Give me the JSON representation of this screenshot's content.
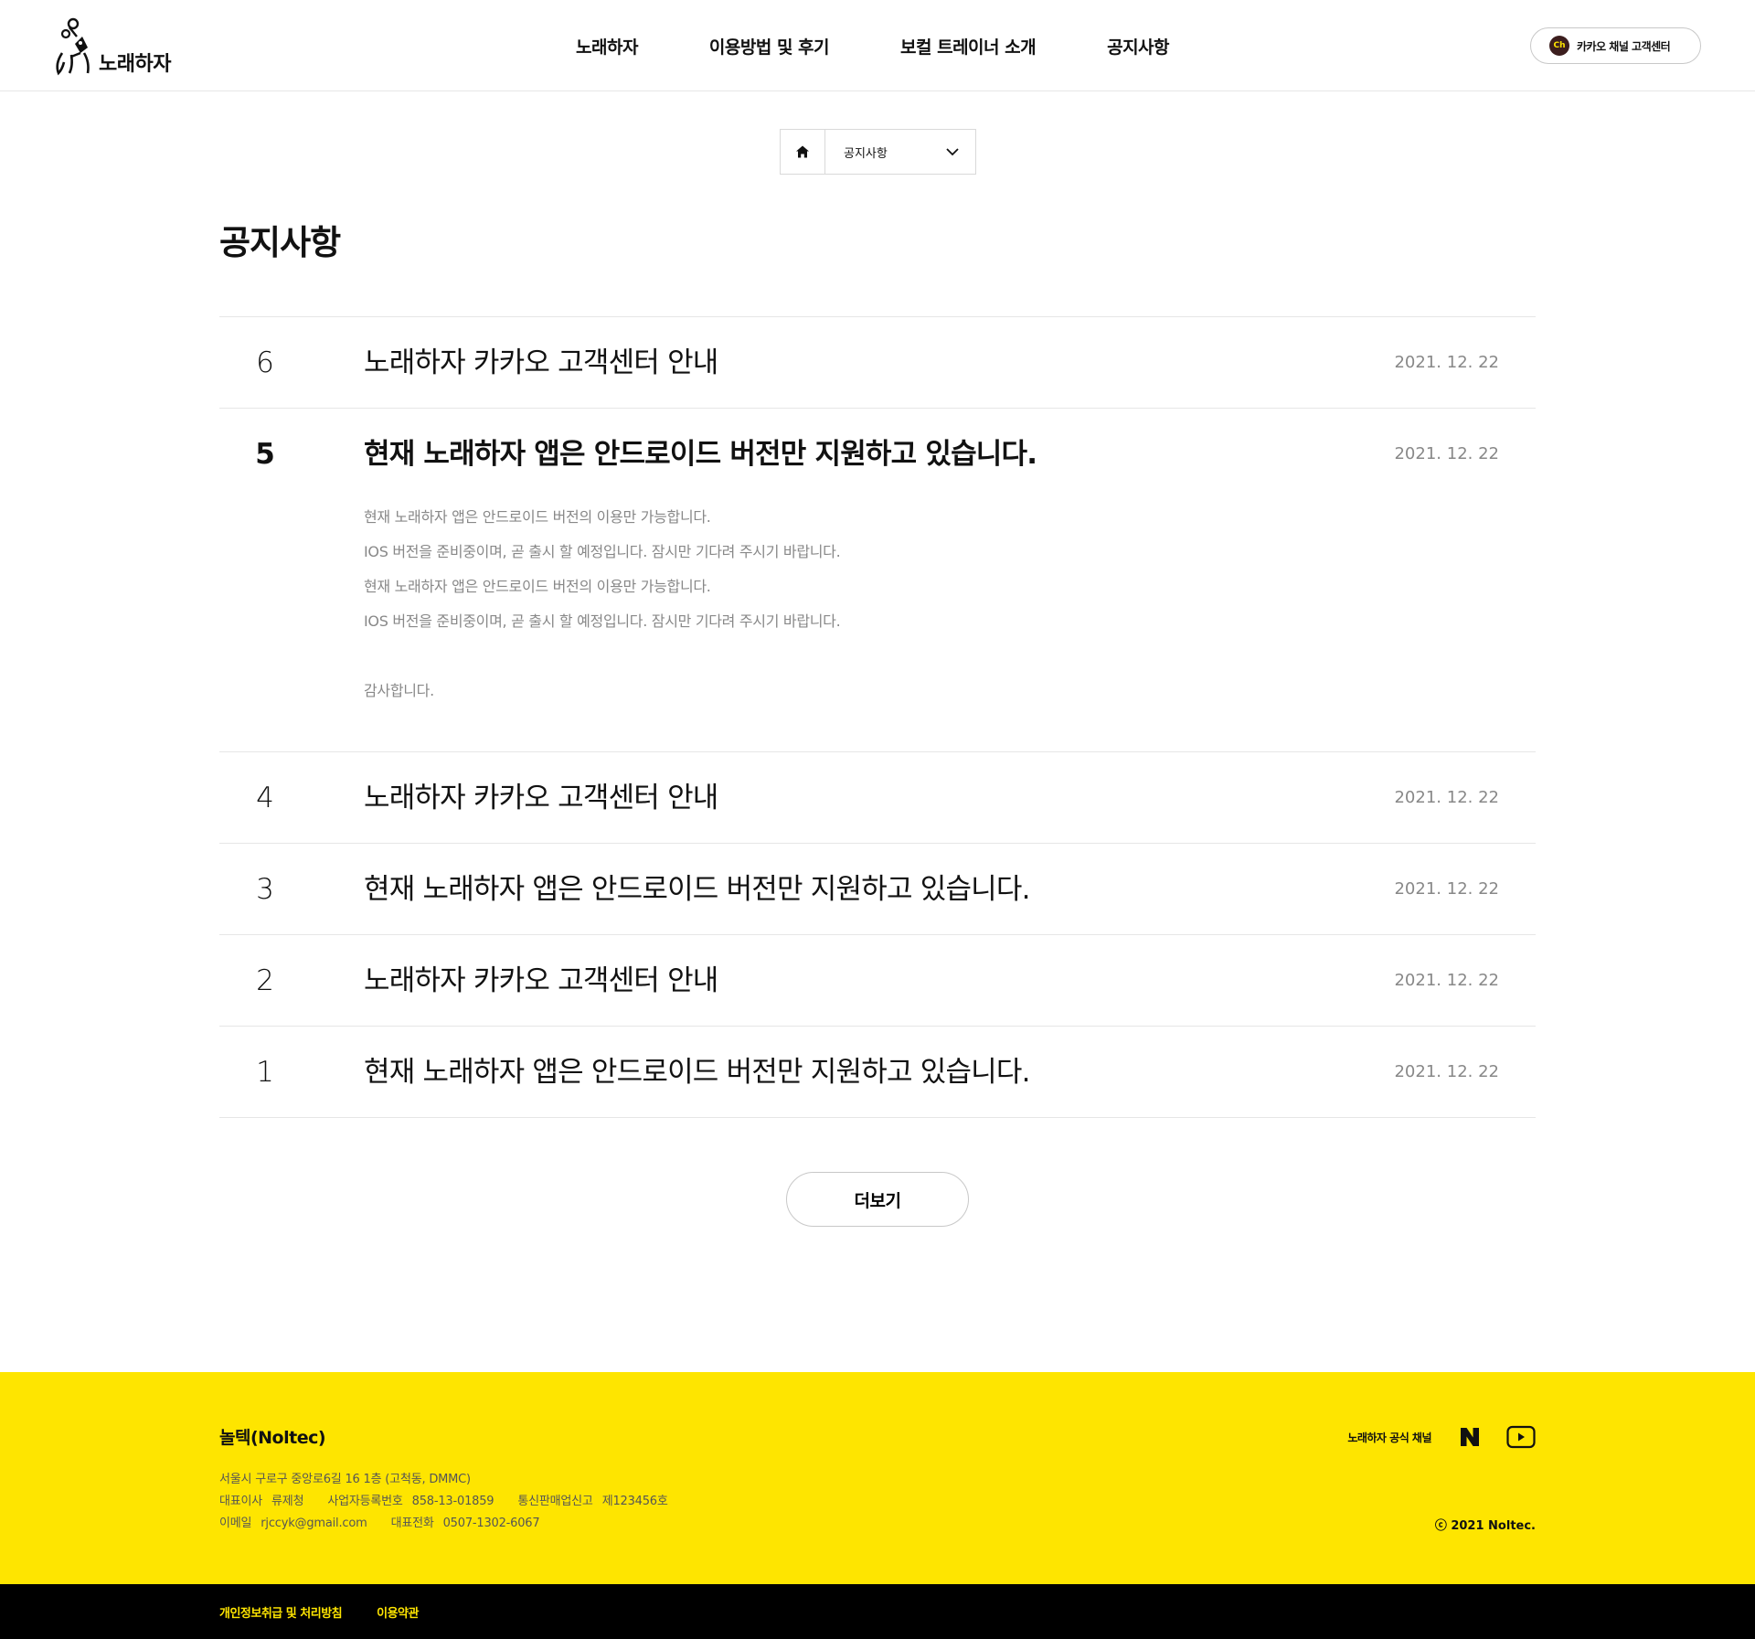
{
  "brand": {
    "name": "노래하자",
    "accent": "#fee500",
    "dark": "#000000"
  },
  "nav": {
    "items": [
      {
        "label": "노래하자",
        "active": false
      },
      {
        "label": "이용방법 및 후기",
        "active": false
      },
      {
        "label": "보컬 트레이너 소개",
        "active": false
      },
      {
        "label": "공지사항",
        "active": true
      }
    ]
  },
  "kakao_button": {
    "badge": "Ch",
    "label": "카카오 채널 고객센터"
  },
  "breadcrumb": {
    "home_icon": "home-icon",
    "selected": "공지사항",
    "chevron_icon": "chevron-down-icon"
  },
  "page": {
    "title": "공지사항"
  },
  "notices": [
    {
      "num": "6",
      "title": "노래하자 카카오 고객센터 안내",
      "date": "2021. 12. 22",
      "open": false
    },
    {
      "num": "5",
      "title": "현재 노래하자 앱은 안드로이드 버전만 지원하고 있습니다.",
      "date": "2021. 12. 22",
      "open": true,
      "body": [
        "현재 노래하자 앱은 안드로이드 버전의 이용만 가능합니다.",
        "IOS 버전을 준비중이며, 곧 출시 할 예정입니다. 잠시만 기다려 주시기 바랍니다.",
        "현재 노래하자 앱은 안드로이드 버전의 이용만 가능합니다.",
        "IOS 버전을 준비중이며, 곧 출시 할 예정입니다. 잠시만 기다려 주시기 바랍니다.",
        "",
        "감사합니다."
      ]
    },
    {
      "num": "4",
      "title": "노래하자 카카오 고객센터 안내",
      "date": "2021. 12. 22",
      "open": false
    },
    {
      "num": "3",
      "title": "현재 노래하자 앱은 안드로이드 버전만 지원하고 있습니다.",
      "date": "2021. 12. 22",
      "open": false
    },
    {
      "num": "2",
      "title": "노래하자 카카오 고객센터 안내",
      "date": "2021. 12. 22",
      "open": false
    },
    {
      "num": "1",
      "title": "현재 노래하자 앱은 안드로이드 버전만 지원하고 있습니다.",
      "date": "2021. 12. 22",
      "open": false
    }
  ],
  "more_button": "더보기",
  "footer": {
    "company": "놀텍(Noltec)",
    "address": "서울시 구로구 중앙로6길 16 1층 (고척동, DMMC)",
    "ceo_label": "대표이사",
    "ceo": "류제청",
    "bizno_label": "사업자등록번호",
    "bizno": "858-13-01859",
    "mailorder_label": "통신판매업신고",
    "mailorder": "제123456호",
    "email_label": "이메일",
    "email": "rjccyk@gmail.com",
    "phone_label": "대표전화",
    "phone": "0507-1302-6067",
    "channel_label": "노래하자 공식 채널",
    "channel_icons": [
      "naver-icon",
      "youtube-icon"
    ],
    "copyright": "ⓒ 2021 Noltec."
  },
  "bottom_links": [
    "개인정보취급 및 처리방침",
    "이용약관"
  ]
}
